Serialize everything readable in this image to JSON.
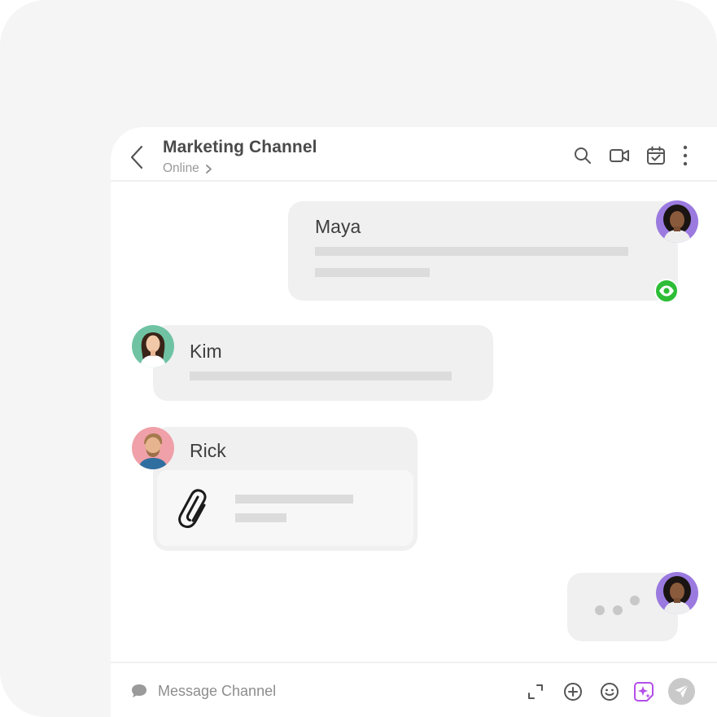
{
  "header": {
    "title": "Marketing Channel",
    "status": "Online"
  },
  "messages": [
    {
      "author": "Maya",
      "side": "outgoing",
      "read": true
    },
    {
      "author": "Kim",
      "side": "incoming"
    },
    {
      "author": "Rick",
      "side": "incoming",
      "attachment": true
    },
    {
      "author": "Maya",
      "side": "outgoing",
      "typing": true
    }
  ],
  "composer": {
    "placeholder": "Message Channel"
  },
  "colors": {
    "read_badge": "#2dbd37",
    "ai_accent": "#b44ee8",
    "avatar_maya_bg": "#9b7ae0",
    "avatar_kim_bg": "#6fc3a3",
    "avatar_rick_bg": "#f0a0a8"
  },
  "icons": {
    "header": [
      "chevron-left-icon",
      "chevron-right-icon",
      "search-icon",
      "video-icon",
      "calendar-check-icon",
      "more-vertical-icon"
    ],
    "message": [
      "eye-icon",
      "paperclip-icon"
    ],
    "composer": [
      "chat-bubble-icon",
      "expand-icon",
      "plus-circle-icon",
      "emoji-icon",
      "ai-sparkle-icon",
      "send-icon"
    ]
  }
}
